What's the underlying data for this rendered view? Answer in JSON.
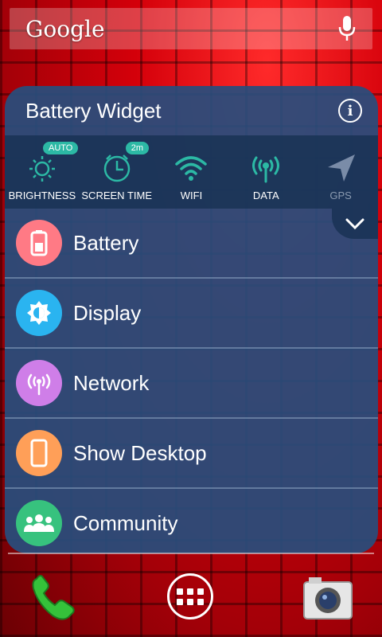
{
  "search": {
    "logo_text": "Google",
    "mic_icon": "mic-icon"
  },
  "widget": {
    "title": "Battery Widget",
    "info_icon": "info-icon",
    "toggles": [
      {
        "label": "BRIGHTNESS",
        "badge": "AUTO",
        "icon": "brightness-icon"
      },
      {
        "label": "SCREEN TIME",
        "badge": "2m",
        "icon": "clock-icon"
      },
      {
        "label": "WIFI",
        "icon": "wifi-icon"
      },
      {
        "label": "DATA",
        "icon": "data-antenna-icon"
      },
      {
        "label": "GPS",
        "icon": "gps-icon",
        "state": "off"
      }
    ],
    "expand_icon": "chevron-down-icon",
    "menu": [
      {
        "label": "Battery",
        "icon": "battery-icon",
        "color": "#ff7a85"
      },
      {
        "label": "Display",
        "icon": "display-brightness-icon",
        "color": "#2ab4f0"
      },
      {
        "label": "Network",
        "icon": "network-antenna-icon",
        "color": "#cf7ee8"
      },
      {
        "label": "Show Desktop",
        "icon": "phone-device-icon",
        "color": "#ff9f58"
      },
      {
        "label": "Community",
        "icon": "people-icon",
        "color": "#37c27e"
      }
    ]
  },
  "dock": {
    "phone_icon": "phone-icon",
    "drawer_icon": "app-drawer-icon",
    "camera_icon": "camera-icon"
  },
  "colors": {
    "widget_bg": "#284e7d",
    "accent": "#2cb9a5",
    "wallpaper": "#d4000a"
  }
}
